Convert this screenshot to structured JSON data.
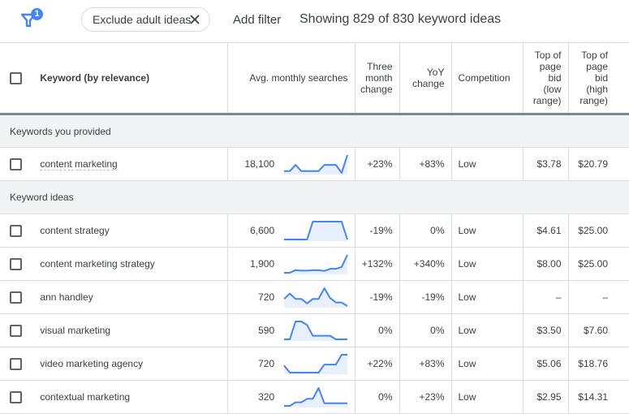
{
  "topbar": {
    "filter_icon": "filter-icon",
    "filter_badge": "1",
    "chip_label": "Exclude adult ideas",
    "chip_close_icon": "close-icon",
    "add_filter": "Add filter",
    "showing": "Showing 829 of 830 keyword ideas"
  },
  "colors": {
    "accent": "#4285f4",
    "sparkline_fill": "#e8f0fe",
    "section_bg": "#f1f3f4",
    "text": "#3c4043"
  },
  "table": {
    "headers": {
      "keyword": "Keyword (by relevance)",
      "avg": "Avg. monthly searches",
      "three_month": [
        "Three",
        "month",
        "change"
      ],
      "yoy": [
        "YoY",
        "change"
      ],
      "competition": "Competition",
      "bid_low": [
        "Top of",
        "page",
        "bid",
        "(low",
        "range)"
      ],
      "bid_high": [
        "Top of",
        "page",
        "bid",
        "(high",
        "range)"
      ]
    },
    "sections": [
      {
        "title": "Keywords you provided",
        "rows": [
          {
            "keyword": "content marketing",
            "avg": "18,100",
            "trend": [
              0.1,
              0.1,
              0.45,
              0.1,
              0.1,
              0.1,
              0.1,
              0.45,
              0.45,
              0.45,
              0.0,
              1.0
            ],
            "three_month": "+23%",
            "yoy": "+83%",
            "competition": "Low",
            "bid_low": "$3.78",
            "bid_high": "$20.79"
          }
        ]
      },
      {
        "title": "Keyword ideas",
        "rows": [
          {
            "keyword": "content strategy",
            "avg": "6,600",
            "trend": [
              0,
              0,
              0,
              0,
              0,
              1,
              1,
              1,
              1,
              1,
              1,
              0
            ],
            "three_month": "-19%",
            "yoy": "0%",
            "competition": "Low",
            "bid_low": "$4.61",
            "bid_high": "$25.00"
          },
          {
            "keyword": "content marketing strategy",
            "avg": "1,900",
            "trend": [
              0,
              0,
              0.15,
              0.12,
              0.12,
              0.14,
              0.14,
              0.1,
              0.22,
              0.22,
              0.32,
              1
            ],
            "three_month": "+132%",
            "yoy": "+340%",
            "competition": "Low",
            "bid_low": "$8.00",
            "bid_high": "$25.00"
          },
          {
            "keyword": "ann handley",
            "avg": "720",
            "trend": [
              0.4,
              0.7,
              0.4,
              0.4,
              0.15,
              0.4,
              0.4,
              1,
              0.45,
              0.2,
              0.2,
              0
            ],
            "three_month": "-19%",
            "yoy": "-19%",
            "competition": "Low",
            "bid_low": "–",
            "bid_high": "–"
          },
          {
            "keyword": "visual marketing",
            "avg": "590",
            "trend": [
              0,
              0,
              1,
              1,
              0.8,
              0.2,
              0.2,
              0.2,
              0.2,
              0,
              0,
              0
            ],
            "three_month": "0%",
            "yoy": "0%",
            "competition": "Low",
            "bid_low": "$3.50",
            "bid_high": "$7.60"
          },
          {
            "keyword": "video marketing agency",
            "avg": "720",
            "trend": [
              0.4,
              0,
              0,
              0,
              0,
              0,
              0,
              0.45,
              0.45,
              0.45,
              1,
              1
            ],
            "three_month": "+22%",
            "yoy": "+83%",
            "competition": "Low",
            "bid_low": "$5.06",
            "bid_high": "$18.76"
          },
          {
            "keyword": "contextual marketing",
            "avg": "320",
            "trend": [
              0,
              0,
              0.2,
              0.2,
              0.4,
              0.4,
              1,
              0.15,
              0.15,
              0.15,
              0.15,
              0.15
            ],
            "three_month": "0%",
            "yoy": "+23%",
            "competition": "Low",
            "bid_low": "$2.95",
            "bid_high": "$14.31"
          }
        ]
      }
    ]
  }
}
